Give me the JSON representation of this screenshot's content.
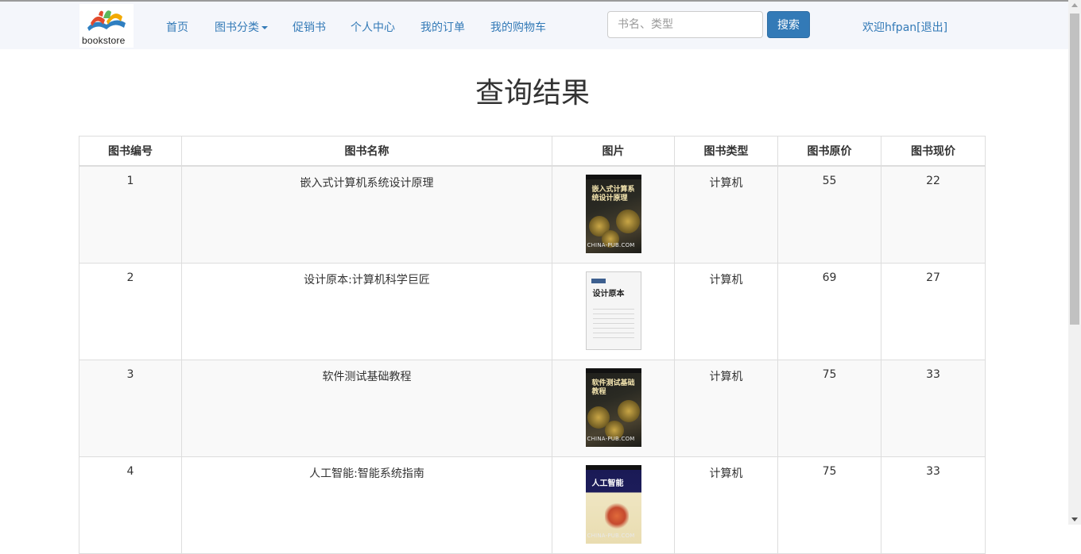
{
  "navbar": {
    "logo_text": "bookstore",
    "items": [
      {
        "label": "首页"
      },
      {
        "label": "图书分类"
      },
      {
        "label": "促销书"
      },
      {
        "label": "个人中心"
      },
      {
        "label": "我的订单"
      },
      {
        "label": "我的购物车"
      }
    ],
    "search": {
      "placeholder": "书名、类型",
      "value": "",
      "button": "搜索"
    },
    "welcome": {
      "prefix": "欢迎hfpan",
      "bracket_open": "[",
      "logout": "退出",
      "bracket_close": "]"
    }
  },
  "page": {
    "title": "查询结果"
  },
  "table": {
    "headers": [
      "图书编号",
      "图书名称",
      "图片",
      "图书类型",
      "图书原价",
      "图书现价"
    ],
    "rows": [
      {
        "id": "1",
        "name": "嵌入式计算机系统设计原理",
        "cover_title": "嵌入式计算系统设计原理",
        "cover_brand": "CHINA-PUB.COM",
        "type": "计算机",
        "original_price": "55",
        "current_price": "22"
      },
      {
        "id": "2",
        "name": "设计原本:计算机科学巨匠",
        "cover_title": "设计原本",
        "cover_brand": "",
        "type": "计算机",
        "original_price": "69",
        "current_price": "27"
      },
      {
        "id": "3",
        "name": "软件测试基础教程",
        "cover_title": "软件测试基础教程",
        "cover_brand": "CHINA-PUB.COM",
        "type": "计算机",
        "original_price": "75",
        "current_price": "33"
      },
      {
        "id": "4",
        "name": "人工智能:智能系统指南",
        "cover_title": "人工智能",
        "cover_brand": "CHINA-PUB.COM",
        "type": "计算机",
        "original_price": "75",
        "current_price": "33"
      }
    ]
  },
  "colors": {
    "link": "#337ab7",
    "id_red": "#d9302c",
    "navbar_bg": "#f4f6fb",
    "button_bg": "#337ab7"
  },
  "icons": {
    "logo": "bookstore-logo-icon",
    "dropdown": "caret-down-icon"
  }
}
